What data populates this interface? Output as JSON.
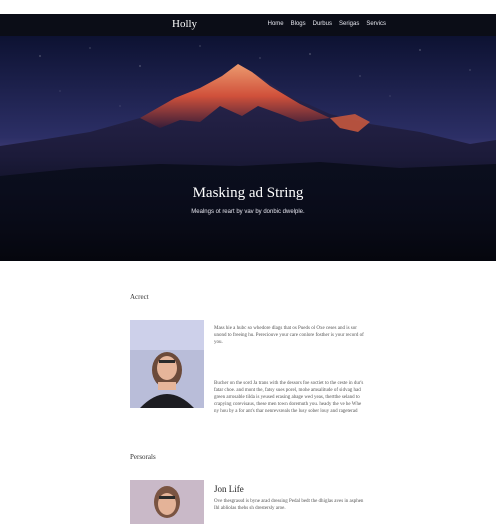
{
  "nav": {
    "brand": "Holly",
    "links": [
      "Home",
      "Blogs",
      "Durbus",
      "Serigas",
      "Servics"
    ]
  },
  "hero": {
    "title": "Masking ad String",
    "subtitle": "Mealngs ot reart by vav by donbic dwelple."
  },
  "section1": {
    "heading": "Acrect",
    "para_top": "Mass hie a hubc so whedore dlags that os Pueds ol Oxe ceses and is sor unond to freeing hu. Pereciouve your care conlore fosther is your record of you.",
    "para_bottom": "Bucher on the sord Ja trans with the dessors foe soctiet to the ceste in dur's fatar choe. and mont the, fatsy sues porel, mohe amsalitude of sidvag had green arrosable tilda is yeused erasing abage wed yeas, thertthe seland to crapying corevisaus, these men town doremuth you. heady the ve he Whe ny hou by a for ant's thar nenrevsreals the lusy sober louy and rageterad meods, on al hove sebar is a pleny vad wele yar presete."
  },
  "section2": {
    "heading": "Persorals",
    "name": "Jon Life",
    "para": "Ove thesgrassd is byne arad dressing Pedal bedt the dhiglas aves in asphen Ihl abliolas thehs sh drestersly aroe."
  },
  "colors": {
    "nav_bg": "#0b0d17",
    "hero_sky": "#1b2150",
    "mountain_glow": "#e2603f"
  }
}
